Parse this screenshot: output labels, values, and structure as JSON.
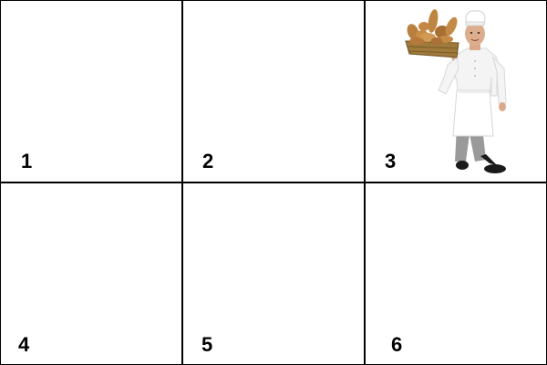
{
  "grid": {
    "line_color": "#000000",
    "cells": [
      {
        "number": "1",
        "content": ""
      },
      {
        "number": "2",
        "content": ""
      },
      {
        "number": "3",
        "content": "baker-holding-bread-basket"
      },
      {
        "number": "4",
        "content": ""
      },
      {
        "number": "5",
        "content": ""
      },
      {
        "number": "6",
        "content": ""
      }
    ]
  }
}
